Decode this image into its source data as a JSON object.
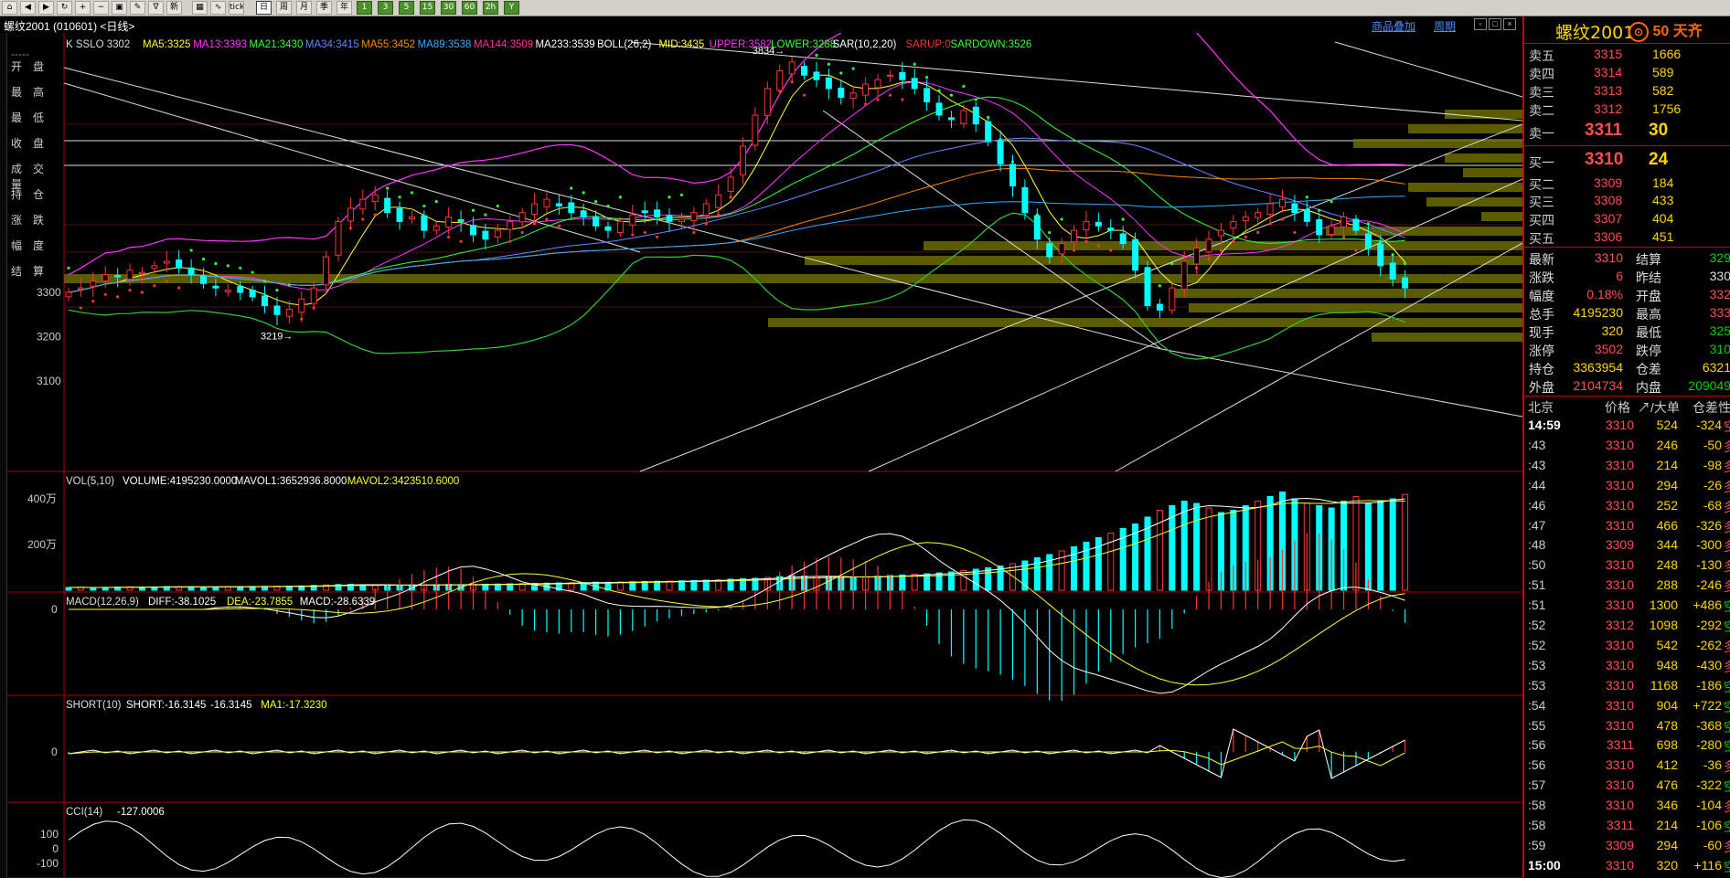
{
  "toolbar": {
    "buttons": [
      {
        "name": "home",
        "label": "⌂"
      },
      {
        "name": "back",
        "label": "◀"
      },
      {
        "name": "fwd",
        "label": "▶"
      },
      {
        "name": "refresh",
        "label": "↻"
      },
      {
        "name": "zoom-in",
        "label": "+"
      },
      {
        "name": "zoom-out",
        "label": "−"
      },
      {
        "name": "save",
        "label": "▣"
      },
      {
        "name": "draw",
        "label": "✎"
      },
      {
        "name": "filter",
        "label": "∇"
      },
      {
        "name": "new",
        "label": "新"
      },
      {
        "name": "tile",
        "label": "▦"
      },
      {
        "name": "indicator",
        "label": "∿"
      },
      {
        "name": "tick",
        "label": "tick"
      }
    ],
    "periods": [
      {
        "label": "日",
        "active": true
      },
      {
        "label": "周",
        "active": false
      },
      {
        "label": "月",
        "active": false
      },
      {
        "label": "季",
        "active": false
      },
      {
        "label": "年",
        "active": false
      }
    ],
    "minute_buttons": [
      "1",
      "3",
      "5",
      "15",
      "30",
      "60",
      "2h",
      "Y"
    ]
  },
  "titlebar": {
    "symbol_title": "螺纹2001 (010601) <日线>",
    "link_overlay": "商品叠加",
    "link_period": "周期"
  },
  "actions": {
    "items": [
      "开盘",
      "最高",
      "最低",
      "收盘",
      "成交量",
      "持仓",
      "涨跌",
      "幅度",
      "结算"
    ]
  },
  "chart_data": [
    {
      "panel": "price",
      "type": "candlestick",
      "header": "K  SSLO 3302",
      "indicators": [
        {
          "label": "MA5:3325",
          "color": "#ffff33"
        },
        {
          "label": "MA13:3393",
          "color": "#ff33ff"
        },
        {
          "label": "MA21:3430",
          "color": "#33ff33"
        },
        {
          "label": "MA34:3415",
          "color": "#6688ff"
        },
        {
          "label": "MA55:3452",
          "color": "#ff8800"
        },
        {
          "label": "MA89:3538",
          "color": "#33aaff"
        },
        {
          "label": "MA144:3509",
          "color": "#ff3399"
        },
        {
          "label": "MA233:3539",
          "color": "#ffffff"
        },
        {
          "label": "BOLL(26,2)",
          "color": "#ffffff"
        },
        {
          "label": "MID:3435",
          "color": "#ffff33"
        },
        {
          "label": "UPPER:3582",
          "color": "#ff33ff"
        },
        {
          "label": "LOWER:3288",
          "color": "#33ff33"
        },
        {
          "label": "SAR(10,2,20)",
          "color": "#ffffff"
        },
        {
          "label": "SARUP:0",
          "color": "#ff3333"
        },
        {
          "label": "SARDOWN:3526",
          "color": "#33ff33"
        }
      ],
      "y_ticks": [
        3300,
        3200,
        3100
      ],
      "ylim": [
        3000,
        3900
      ],
      "annotations": [
        {
          "text": "3834→",
          "value": 3834
        },
        {
          "text": "3219→",
          "value": 3219
        }
      ],
      "close": [
        3300,
        3310,
        3325,
        3340,
        3335,
        3350,
        3345,
        3360,
        3370,
        3355,
        3340,
        3320,
        3310,
        3305,
        3300,
        3290,
        3270,
        3250,
        3262,
        3285,
        3310,
        3380,
        3460,
        3490,
        3510,
        3520,
        3480,
        3460,
        3470,
        3440,
        3450,
        3470,
        3460,
        3430,
        3420,
        3440,
        3460,
        3480,
        3500,
        3510,
        3495,
        3480,
        3470,
        3450,
        3440,
        3460,
        3475,
        3480,
        3470,
        3460,
        3465,
        3480,
        3500,
        3520,
        3560,
        3630,
        3700,
        3760,
        3800,
        3820,
        3790,
        3780,
        3760,
        3740,
        3750,
        3770,
        3780,
        3790,
        3780,
        3760,
        3730,
        3700,
        3690,
        3710,
        3680,
        3640,
        3590,
        3540,
        3480,
        3420,
        3380,
        3410,
        3440,
        3460,
        3450,
        3440,
        3410,
        3350,
        3270,
        3260,
        3310,
        3370,
        3400,
        3420,
        3440,
        3460,
        3470,
        3480,
        3500,
        3510,
        3480,
        3460,
        3430,
        3450,
        3470,
        3440,
        3400,
        3360,
        3330,
        3310
      ]
    },
    {
      "panel": "volume",
      "type": "bar",
      "header": "VOL(5,10)",
      "indicators": [
        {
          "label": "VOLUME:4195230.0000",
          "color": "#ffffff"
        },
        {
          "label": "MAVOL1:3652936.8000",
          "color": "#ffffff"
        },
        {
          "label": "MAVOL2:3423510.6000",
          "color": "#ffff33"
        }
      ],
      "y_tick_labels": [
        "400万",
        "200万"
      ],
      "values": [
        120,
        130,
        110,
        125,
        140,
        150,
        135,
        145,
        160,
        150,
        155,
        140,
        145,
        150,
        160,
        165,
        170,
        180,
        175,
        190,
        210,
        230,
        250,
        260,
        240,
        230,
        220,
        215,
        225,
        235,
        240,
        250,
        245,
        260,
        255,
        270,
        280,
        290,
        300,
        310,
        320,
        330,
        340,
        350,
        345,
        360,
        370,
        380,
        390,
        400,
        410,
        420,
        440,
        460,
        480,
        500,
        520,
        560,
        600,
        640,
        620,
        600,
        580,
        560,
        570,
        590,
        610,
        640,
        670,
        700,
        720,
        760,
        800,
        860,
        920,
        980,
        1060,
        1160,
        1280,
        1420,
        1560,
        1720,
        1900,
        2100,
        2300,
        2500,
        2700,
        2900,
        3200,
        3500,
        3700,
        3900,
        3800,
        3600,
        3400,
        3500,
        3700,
        3900,
        4100,
        4300,
        4000,
        3800,
        3700,
        3600,
        3900,
        4100,
        3800,
        3900,
        4000,
        4195
      ]
    },
    {
      "panel": "macd",
      "type": "bar",
      "header": "MACD(12,26,9)",
      "indicators": [
        {
          "label": "DIFF:-38.1025",
          "color": "#ffffff"
        },
        {
          "label": "DEA:-23.7855",
          "color": "#ffff33"
        },
        {
          "label": "MACD:-28.6339",
          "color": "#ffffff"
        }
      ],
      "y_tick_labels": [
        "0"
      ]
    },
    {
      "panel": "short",
      "type": "bar",
      "header": "SHORT(10)",
      "indicators": [
        {
          "label": "SHORT:-16.3145",
          "color": "#ffffff"
        },
        {
          "label": "-16.3145",
          "color": "#ffffff"
        },
        {
          "label": "MA1:-17.3230",
          "color": "#ffff33"
        }
      ],
      "y_tick_labels": [
        "0"
      ]
    },
    {
      "panel": "cci",
      "type": "line",
      "header": "CCI(14)",
      "indicators": [
        {
          "label": "-127.0006",
          "color": "#ffffff"
        }
      ],
      "y_tick_labels": [
        "100",
        "0",
        "-100"
      ]
    }
  ],
  "quote": {
    "symbol": "螺纹2001",
    "logo": "50 天齐",
    "sell": [
      {
        "label": "卖五",
        "price": "3315",
        "vol": "1666"
      },
      {
        "label": "卖四",
        "price": "3314",
        "vol": "589"
      },
      {
        "label": "卖三",
        "price": "3313",
        "vol": "582"
      },
      {
        "label": "卖二",
        "price": "3312",
        "vol": "1756"
      },
      {
        "label": "卖一",
        "price": "3311",
        "vol": "30"
      }
    ],
    "buy": [
      {
        "label": "买一",
        "price": "3310",
        "vol": "24"
      },
      {
        "label": "买二",
        "price": "3309",
        "vol": "184"
      },
      {
        "label": "买三",
        "price": "3308",
        "vol": "433"
      },
      {
        "label": "买四",
        "price": "3307",
        "vol": "404"
      },
      {
        "label": "买五",
        "price": "3306",
        "vol": "451"
      }
    ],
    "stats": [
      {
        "l1": "最新",
        "v1": "3310",
        "c1": "red",
        "l2": "结算",
        "v2": "329",
        "c2": "grn"
      },
      {
        "l1": "涨跌",
        "v1": "6",
        "c1": "red",
        "l2": "昨结",
        "v2": "330",
        "c2": "wht"
      },
      {
        "l1": "幅度",
        "v1": "0.18%",
        "c1": "red",
        "l2": "开盘",
        "v2": "332",
        "c2": "red"
      },
      {
        "l1": "总手",
        "v1": "4195230",
        "c1": "yel",
        "l2": "最高",
        "v2": "333",
        "c2": "red"
      },
      {
        "l1": "现手",
        "v1": "320",
        "c1": "yel",
        "l2": "最低",
        "v2": "325",
        "c2": "grn"
      },
      {
        "l1": "涨停",
        "v1": "3502",
        "c1": "red",
        "l2": "跌停",
        "v2": "310",
        "c2": "grn"
      },
      {
        "l1": "持仓",
        "v1": "3363954",
        "c1": "yel",
        "l2": "仓差",
        "v2": "6321",
        "c2": "yel"
      },
      {
        "l1": "外盘",
        "v1": "2104734",
        "c1": "red",
        "l2": "内盘",
        "v2": "209049",
        "c2": "grn"
      }
    ],
    "tick_header": {
      "time": "北京",
      "price": "价格",
      "vol": "↗/大单",
      "oi": "仓差",
      "nature": "性"
    },
    "ticks": [
      {
        "t": "14:59",
        "p": "3310",
        "pc": "red",
        "v": "524",
        "o": "-324",
        "oc": "yel",
        "n": "空",
        "nc": "red"
      },
      {
        "t": ":43",
        "p": "3310",
        "pc": "red",
        "v": "246",
        "o": "-50",
        "oc": "yel",
        "n": "多",
        "nc": "red"
      },
      {
        "t": ":43",
        "p": "3310",
        "pc": "red",
        "v": "214",
        "o": "-98",
        "oc": "yel",
        "n": "多",
        "nc": "red"
      },
      {
        "t": ":44",
        "p": "3310",
        "pc": "red",
        "v": "294",
        "o": "-26",
        "oc": "yel",
        "n": "多",
        "nc": "red"
      },
      {
        "t": ":46",
        "p": "3310",
        "pc": "red",
        "v": "252",
        "o": "-68",
        "oc": "yel",
        "n": "多",
        "nc": "red"
      },
      {
        "t": ":47",
        "p": "3310",
        "pc": "red",
        "v": "466",
        "o": "-326",
        "oc": "yel",
        "n": "多",
        "nc": "red"
      },
      {
        "t": ":48",
        "p": "3309",
        "pc": "red",
        "v": "344",
        "o": "-300",
        "oc": "yel",
        "n": "多",
        "nc": "red"
      },
      {
        "t": ":50",
        "p": "3310",
        "pc": "red",
        "v": "248",
        "o": "-130",
        "oc": "yel",
        "n": "多",
        "nc": "red"
      },
      {
        "t": ":51",
        "p": "3310",
        "pc": "red",
        "v": "288",
        "o": "-246",
        "oc": "yel",
        "n": "多",
        "nc": "red"
      },
      {
        "t": ":51",
        "p": "3310",
        "pc": "red",
        "v": "1300",
        "o": "+486",
        "oc": "yel",
        "n": "空",
        "nc": "grn"
      },
      {
        "t": ":52",
        "p": "3312",
        "pc": "red",
        "v": "1098",
        "o": "-292",
        "oc": "yel",
        "n": "空",
        "nc": "grn"
      },
      {
        "t": ":52",
        "p": "3310",
        "pc": "red",
        "v": "542",
        "o": "-262",
        "oc": "yel",
        "n": "多",
        "nc": "red"
      },
      {
        "t": ":53",
        "p": "3310",
        "pc": "red",
        "v": "948",
        "o": "-430",
        "oc": "yel",
        "n": "多",
        "nc": "red"
      },
      {
        "t": ":53",
        "p": "3310",
        "pc": "red",
        "v": "1168",
        "o": "-186",
        "oc": "yel",
        "n": "空",
        "nc": "grn"
      },
      {
        "t": ":54",
        "p": "3310",
        "pc": "red",
        "v": "904",
        "o": "+722",
        "oc": "yel",
        "n": "空",
        "nc": "grn"
      },
      {
        "t": ":55",
        "p": "3310",
        "pc": "red",
        "v": "478",
        "o": "-368",
        "oc": "yel",
        "n": "空",
        "nc": "grn"
      },
      {
        "t": ":56",
        "p": "3311",
        "pc": "red",
        "v": "698",
        "o": "-280",
        "oc": "yel",
        "n": "空",
        "nc": "grn"
      },
      {
        "t": ":56",
        "p": "3310",
        "pc": "red",
        "v": "412",
        "o": "-36",
        "oc": "yel",
        "n": "多",
        "nc": "red"
      },
      {
        "t": ":57",
        "p": "3310",
        "pc": "red",
        "v": "476",
        "o": "-322",
        "oc": "yel",
        "n": "空",
        "nc": "grn"
      },
      {
        "t": ":58",
        "p": "3310",
        "pc": "red",
        "v": "346",
        "o": "-104",
        "oc": "yel",
        "n": "多",
        "nc": "red"
      },
      {
        "t": ":58",
        "p": "3311",
        "pc": "red",
        "v": "214",
        "o": "-106",
        "oc": "yel",
        "n": "空",
        "nc": "grn"
      },
      {
        "t": ":59",
        "p": "3309",
        "pc": "red",
        "v": "294",
        "o": "-60",
        "oc": "yel",
        "n": "多",
        "nc": "red"
      },
      {
        "t": "15:00",
        "p": "3310",
        "pc": "red",
        "v": "320",
        "o": "+116",
        "oc": "yel",
        "n": "空",
        "nc": "grn"
      }
    ]
  }
}
